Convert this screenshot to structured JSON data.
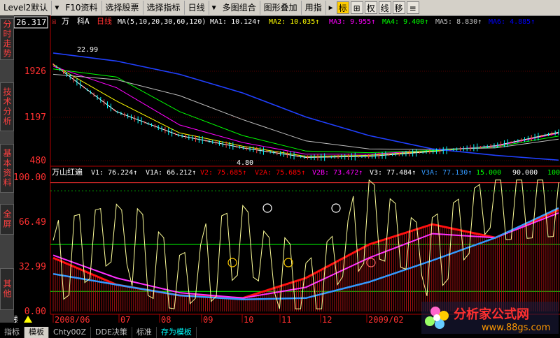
{
  "toolbar": {
    "items": [
      "Level2默认",
      "F10资料",
      "选择股票",
      "选择指标",
      "日线",
      "多图组合",
      "图形叠加",
      "用指"
    ],
    "icons": [
      "标",
      "⊞",
      "权",
      "线",
      "移",
      "≡"
    ]
  },
  "sidebar": {
    "tabs": [
      "分时走势",
      "技术分析",
      "基本资料",
      "全屏",
      "其他"
    ]
  },
  "main_panel": {
    "price_box": "26.317",
    "header_prefix": "万",
    "header_mid": "科A",
    "period": "日线",
    "ma_params": "MA(5,10,20,30,60,120)",
    "ma_values": [
      {
        "label": "MA1: 10.124↑",
        "color": "#ffffff"
      },
      {
        "label": "MA2: 10.035↑",
        "color": "#ffff00"
      },
      {
        "label": "MA3: 9.955↑",
        "color": "#ff00ff"
      },
      {
        "label": "MA4: 9.400↑",
        "color": "#00ff00"
      },
      {
        "label": "MA5: 8.830↑",
        "color": "#c0c0c0"
      },
      {
        "label": "MA6: 4.885↑",
        "color": "#0000ff"
      }
    ],
    "y_ticks": [
      "1926",
      "1197",
      "480"
    ],
    "annotations": [
      "22.99",
      "4.80"
    ]
  },
  "sub_panel": {
    "name": "万山红遍",
    "values": [
      {
        "label": "V1: 76.224↑",
        "color": "#ffffff"
      },
      {
        "label": "V1A: 66.212↑",
        "color": "#ffffff"
      },
      {
        "label": "V2: 75.685↑",
        "color": "#ff0000"
      },
      {
        "label": "V2A: 75.685↑",
        "color": "#ff0000"
      },
      {
        "label": "V2B: 73.472↑",
        "color": "#ff00ff"
      },
      {
        "label": "V3: 77.484↑",
        "color": "#ffffff"
      },
      {
        "label": "V3A: 77.130↑",
        "color": "#3399ff"
      },
      {
        "label": "15.000",
        "color": "#00ff00"
      },
      {
        "label": "90.000",
        "color": "#ffffff"
      },
      {
        "label": "100",
        "color": "#00ff00"
      }
    ],
    "y_ticks": [
      "100.00",
      "66.49",
      "32.99",
      "0.00"
    ]
  },
  "x_axis": {
    "period_label": "日线",
    "ticks": [
      "2008/06",
      "07",
      "08",
      "09",
      "10",
      "11",
      "12",
      "2009/02"
    ]
  },
  "bottom_tabs": [
    "指标",
    "模板",
    "Chty00Z",
    "DDE决策",
    "标准",
    "存为模板"
  ],
  "watermark": {
    "title": "分析家公式网",
    "url": "www.88gs.com"
  },
  "chart_data": [
    {
      "type": "line",
      "panel": "price",
      "ylabel": "",
      "x": [
        "2008/06",
        "07",
        "08",
        "09",
        "10",
        "11",
        "12",
        "2009/02",
        "end"
      ],
      "series": [
        {
          "name": "MA1",
          "values": [
            22.9,
            14.0,
            9.5,
            7.2,
            5.4,
            5.6,
            6.5,
            7.6,
            10.12
          ]
        },
        {
          "name": "MA2",
          "values": [
            22.8,
            16.0,
            10.0,
            7.5,
            5.6,
            5.8,
            6.6,
            7.5,
            10.03
          ]
        },
        {
          "name": "MA3",
          "values": [
            22.5,
            18.5,
            11.5,
            8.2,
            6.0,
            6.0,
            6.7,
            7.5,
            9.95
          ]
        },
        {
          "name": "MA4",
          "values": [
            22.0,
            20.5,
            14.0,
            9.5,
            6.6,
            6.3,
            6.7,
            7.4,
            9.4
          ]
        },
        {
          "name": "MA5",
          "values": [
            21.0,
            20.0,
            17.0,
            12.5,
            8.5,
            7.0,
            6.9,
            7.2,
            8.83
          ]
        },
        {
          "name": "MA6",
          "values": [
            25.0,
            23.5,
            21.0,
            17.5,
            13.0,
            9.5,
            7.0,
            5.8,
            4.89
          ]
        }
      ],
      "ylim": [
        4.8,
        26.3
      ]
    },
    {
      "type": "line",
      "panel": "indicator",
      "x": [
        "2008/06",
        "07",
        "08",
        "09",
        "10",
        "11",
        "12",
        "2009/02",
        "end"
      ],
      "series": [
        {
          "name": "V2",
          "values": [
            40,
            20,
            12,
            10,
            25,
            50,
            65,
            55,
            75.7
          ]
        },
        {
          "name": "V2B",
          "values": [
            42,
            25,
            14,
            10,
            18,
            40,
            58,
            55,
            73.5
          ]
        },
        {
          "name": "V3A",
          "values": [
            28,
            20,
            12,
            9,
            10,
            22,
            38,
            55,
            77.1
          ]
        },
        {
          "name": "V1",
          "values": [
            35,
            60,
            20,
            55,
            10,
            70,
            40,
            85,
            76.2
          ]
        }
      ],
      "ylim": [
        0,
        100
      ],
      "reference_lines": [
        15,
        50,
        90,
        100
      ]
    }
  ]
}
